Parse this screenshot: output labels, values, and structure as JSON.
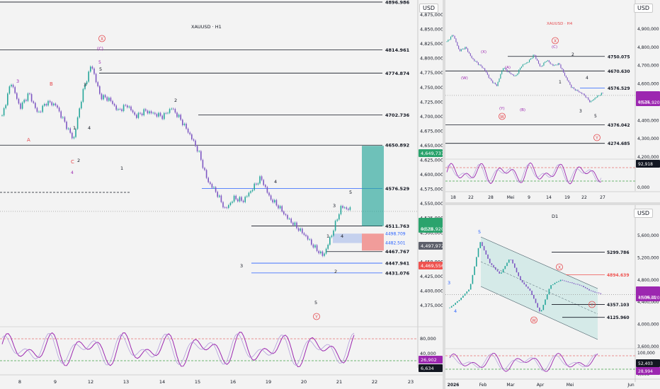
{
  "currency": "USD",
  "colors": {
    "bull": "#26a69a",
    "bear": "#ef5350",
    "wave_red": "#e5484d",
    "wave_purple": "#9c27b0",
    "level": "#131722",
    "trendline": "#2962ff",
    "tp_zone": "#26a69a",
    "sl_zone": "#ef5350",
    "osc_main": "#9c27b0",
    "osc_signal": "#e57373",
    "candle": "#7e57c2"
  },
  "main": {
    "title": "XAUUSD · H1",
    "price_axis": [
      "4,875,000",
      "4,850,000",
      "4,825,000",
      "4,800,000",
      "4,775,000",
      "4,750,000",
      "4,725,000",
      "4,700,000",
      "4,675,000",
      "4,650,000",
      "4,625,000",
      "4,600,000",
      "4,575,000",
      "4,550,000",
      "4,525,000",
      "4,500,000",
      "4,475,000",
      "4,450,000",
      "4,425,000",
      "4,400,000",
      "4,375,000"
    ],
    "levels": [
      "4896.986",
      "4814.961",
      "4774.874",
      "4702.736",
      "4650.892",
      "4576.529",
      "4511.763",
      "4467.767",
      "4447.941",
      "4431.076"
    ],
    "zone_labels": {
      "upper": "4498.709",
      "lower": "4482.501"
    },
    "badges": {
      "tp": "4,649,737",
      "price": "4,536,920",
      "countdown": "06:23",
      "ref": "4,497,972",
      "sl": "4,469,556"
    },
    "osc_axis": [
      "80,000",
      "40,000"
    ],
    "osc_badges": {
      "main": "26,902",
      "signal": "6,634"
    },
    "time_axis": [
      "8",
      "9",
      "12",
      "13",
      "14",
      "15",
      "16",
      "19",
      "20",
      "21",
      "22",
      "23"
    ],
    "wave_labels": {
      "x_circle": "X",
      "c_paren": "(C)",
      "five_purple": "5",
      "five_a": "5",
      "three_a": "3",
      "three_b": "3",
      "two_a": "2",
      "one_a": "1",
      "four_a": "4",
      "b_red": "B",
      "a_red": "A",
      "c_red": "C",
      "two_b": "2",
      "one_b": "1",
      "four_purple": "4",
      "four_b": "4",
      "five_b": "5",
      "three_c": "3",
      "one_c": "1",
      "four_c": "4",
      "two_c": "2",
      "three_d": "3",
      "five_c": "5",
      "y_circle": "Y",
      "three_purple": "3"
    }
  },
  "h4": {
    "title": "XAUUSD · H4",
    "price_axis": [
      "4,900,000",
      "4,800,000",
      "4,700,000",
      "4,600,000",
      "4,500,000",
      "4,400,000",
      "4,300,000",
      "4,200,000"
    ],
    "levels": [
      "4750.075",
      "4670.630",
      "4576.529",
      "4376.042",
      "4274.685"
    ],
    "badges": {
      "price": "4,536,920",
      "countdown": "06:23"
    },
    "osc_axis": [
      "100,000",
      "0,000"
    ],
    "osc_badge": "92,918",
    "time_axis": [
      "18",
      "22",
      "28",
      "Mei",
      "9",
      "14",
      "19",
      "22",
      "27"
    ],
    "wave_labels": {
      "x_circle": "X",
      "c_paren": "(C)",
      "x_paren": "(X)",
      "w_paren": "(W)",
      "a_paren": "(A)",
      "b_paren": "(B)",
      "y_paren": "(Y)",
      "w_circle": "W",
      "two": "2",
      "one": "1",
      "four": "4",
      "three": "3",
      "five": "5",
      "y_circle": "Y"
    }
  },
  "d1": {
    "title": "D1",
    "price_axis": [
      "5,600,000",
      "5,200,000",
      "4,800,000",
      "4,400,000",
      "4,000,000",
      "3,600,000"
    ],
    "levels": [
      "5299.786",
      "4894.639",
      "4357.103",
      "4125.960"
    ],
    "badges": {
      "price": "4,536,920",
      "countdown": "16:06:23"
    },
    "osc_axis": [
      "100,000",
      "0,000"
    ],
    "osc_badges": {
      "main": "52,403",
      "signal": "28,994"
    },
    "time_axis": [
      "2026",
      "Feb",
      "Mar",
      "Apr",
      "Mei",
      "Jun"
    ],
    "wave_labels": {
      "three": "3",
      "four": "4",
      "five": "5",
      "x_circle": "X",
      "y_circle": "Y",
      "w_circle": "W"
    }
  }
}
